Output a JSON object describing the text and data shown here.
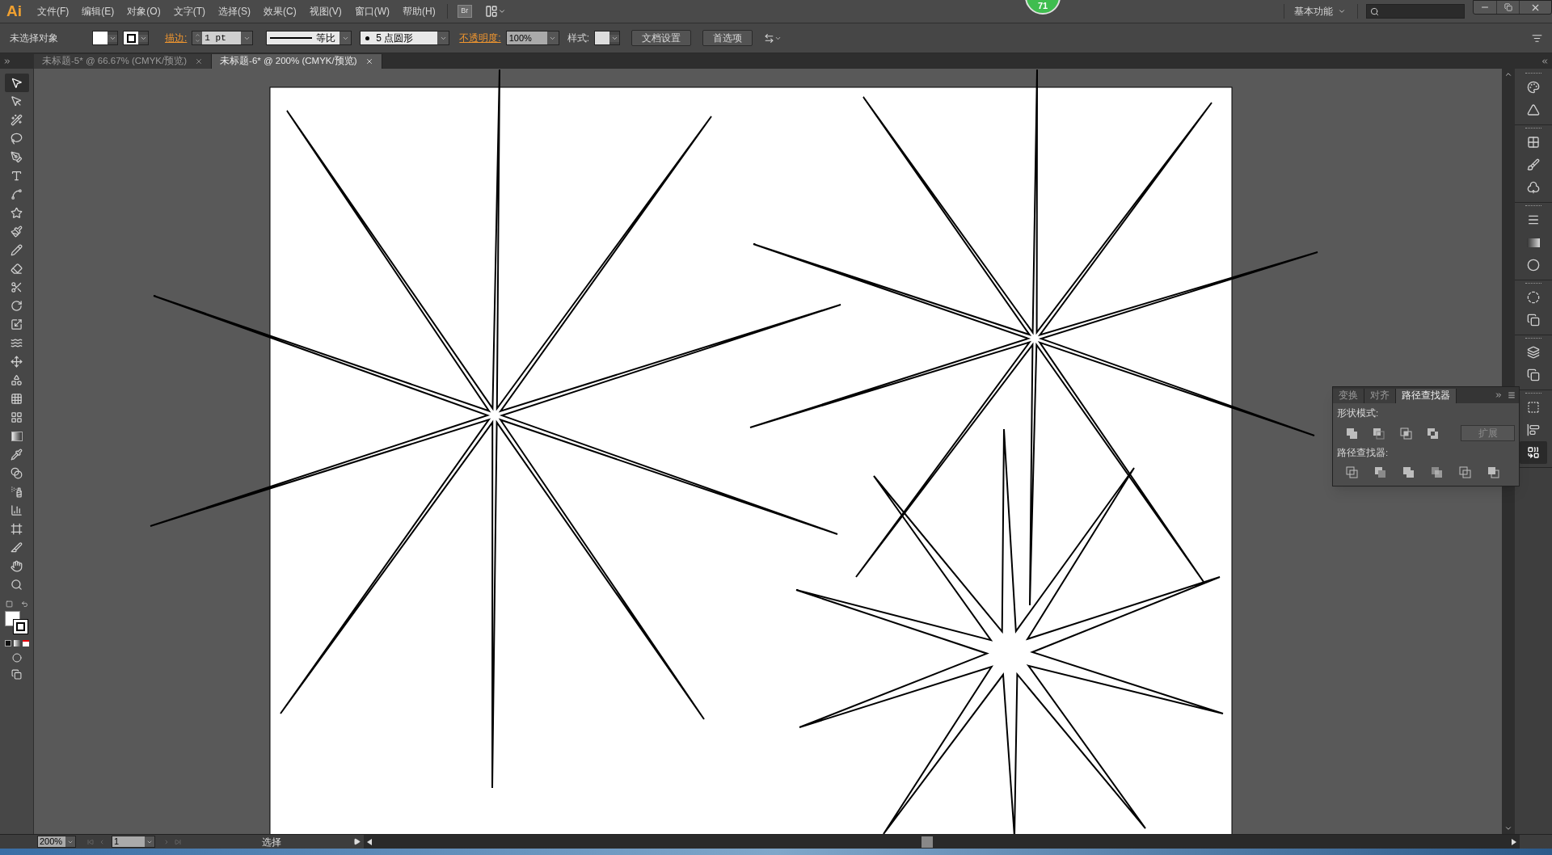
{
  "app": {
    "logo": "Ai",
    "menus": [
      "文件(F)",
      "编辑(E)",
      "对象(O)",
      "文字(T)",
      "选择(S)",
      "效果(C)",
      "视图(V)",
      "窗口(W)",
      "帮助(H)"
    ],
    "bridge": "Br",
    "badge": "71",
    "workspace": "基本功能"
  },
  "control_bar": {
    "selection": "未选择对象",
    "stroke_label": "描边:",
    "stroke_weight": "1 pt",
    "profile": "等比",
    "brush": "5 点圆形",
    "opacity_label": "不透明度:",
    "opacity": "100%",
    "style_label": "样式:",
    "buttons": [
      "文档设置",
      "首选项"
    ]
  },
  "tabs": [
    {
      "label": "未标题-5* @ 66.67% (CMYK/预览)",
      "selected": false
    },
    {
      "label": "未标题-6* @ 200% (CMYK/预览)",
      "selected": true
    }
  ],
  "tools": [
    {
      "kind": "selection",
      "selected": true
    },
    {
      "kind": "direct",
      "selected": false
    },
    {
      "kind": "wand",
      "selected": false
    },
    {
      "kind": "lasso",
      "selected": false
    },
    {
      "kind": "pen",
      "selected": false
    },
    {
      "kind": "type",
      "selected": false
    },
    {
      "kind": "arc",
      "selected": false
    },
    {
      "kind": "star",
      "selected": false
    },
    {
      "kind": "brush",
      "selected": false
    },
    {
      "kind": "pencil",
      "selected": false
    },
    {
      "kind": "blob",
      "selected": false
    },
    {
      "kind": "scissors",
      "selected": false
    },
    {
      "kind": "rotate",
      "selected": false
    },
    {
      "kind": "scale",
      "selected": false
    },
    {
      "kind": "warp",
      "selected": false
    },
    {
      "kind": "transform",
      "selected": false
    },
    {
      "kind": "builder",
      "selected": false
    },
    {
      "kind": "perspective",
      "selected": false
    },
    {
      "kind": "mesh",
      "selected": false
    },
    {
      "kind": "gradient",
      "selected": false
    },
    {
      "kind": "eyedropper",
      "selected": false
    },
    {
      "kind": "blend",
      "selected": false
    },
    {
      "kind": "spray",
      "selected": false
    },
    {
      "kind": "graph",
      "selected": false
    },
    {
      "kind": "artboard",
      "selected": false
    },
    {
      "kind": "slice",
      "selected": false
    },
    {
      "kind": "hand",
      "selected": false
    },
    {
      "kind": "zoom",
      "selected": false
    }
  ],
  "dock": [
    [
      {
        "kind": "color",
        "selected": false
      },
      {
        "kind": "guide",
        "selected": false
      }
    ],
    [
      {
        "kind": "swatches",
        "selected": false
      },
      {
        "kind": "brushes",
        "selected": false
      },
      {
        "kind": "symbols",
        "selected": false
      }
    ],
    [
      {
        "kind": "stroke",
        "selected": false
      },
      {
        "kind": "gradient",
        "selected": false
      },
      {
        "kind": "transparency",
        "selected": false
      }
    ],
    [
      {
        "kind": "appearance",
        "selected": false
      },
      {
        "kind": "styles",
        "selected": false
      }
    ],
    [
      {
        "kind": "layers",
        "selected": false
      },
      {
        "kind": "artboards",
        "selected": false
      }
    ],
    [
      {
        "kind": "transform",
        "selected": false
      },
      {
        "kind": "align",
        "selected": false
      },
      {
        "kind": "pathfinder",
        "selected": true
      }
    ]
  ],
  "pathfinder_panel": {
    "tabs": [
      {
        "label": "变换",
        "selected": false
      },
      {
        "label": "对齐",
        "selected": false
      },
      {
        "label": "路径查找器",
        "selected": true
      }
    ],
    "shape_modes_label": "形状模式:",
    "shape_modes": [
      {
        "kind": "unite"
      },
      {
        "kind": "minus"
      },
      {
        "kind": "intersect"
      },
      {
        "kind": "exclude"
      }
    ],
    "expand": {
      "label": "扩展",
      "disabled": true
    },
    "pathfinders_label": "路径查找器:",
    "pathfinders": [
      {
        "kind": "divide"
      },
      {
        "kind": "trim"
      },
      {
        "kind": "merge"
      },
      {
        "kind": "crop"
      },
      {
        "kind": "outline"
      },
      {
        "kind": "minusback"
      }
    ]
  },
  "status_bar": {
    "zoom": "200%",
    "page": "1",
    "status": "选择"
  }
}
